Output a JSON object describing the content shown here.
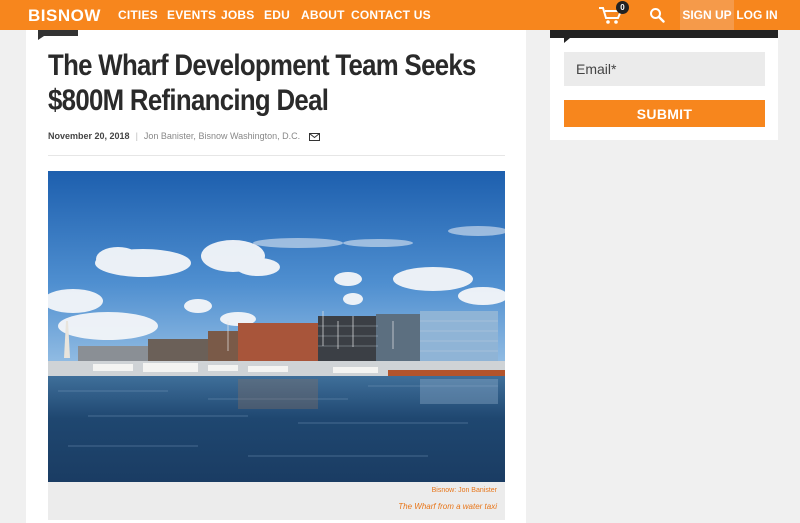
{
  "nav": {
    "logo": "BISNOW",
    "items": [
      "CITIES",
      "EVENTS",
      "JOBS",
      "EDU",
      "ABOUT",
      "CONTACT US"
    ],
    "cart_count": "0",
    "cart_icon": "cart-icon",
    "search_icon": "search-icon",
    "signup": "SIGN UP",
    "login": "LOG IN",
    "accent_color": "#f7861d"
  },
  "article": {
    "headline_line1": "The Wharf Development Team Seeks",
    "headline_line2": "$800M Refinancing Deal",
    "date": "November 20, 2018",
    "separator": "|",
    "author": "Jon Banister, Bisnow Washington, D.C.",
    "mail_icon": "mail-icon",
    "photo_credit": "Bisnow: Jon Banister",
    "photo_caption": "The Wharf from a water taxi"
  },
  "sidebar": {
    "email_placeholder": "Email*",
    "submit_label": "SUBMIT"
  }
}
